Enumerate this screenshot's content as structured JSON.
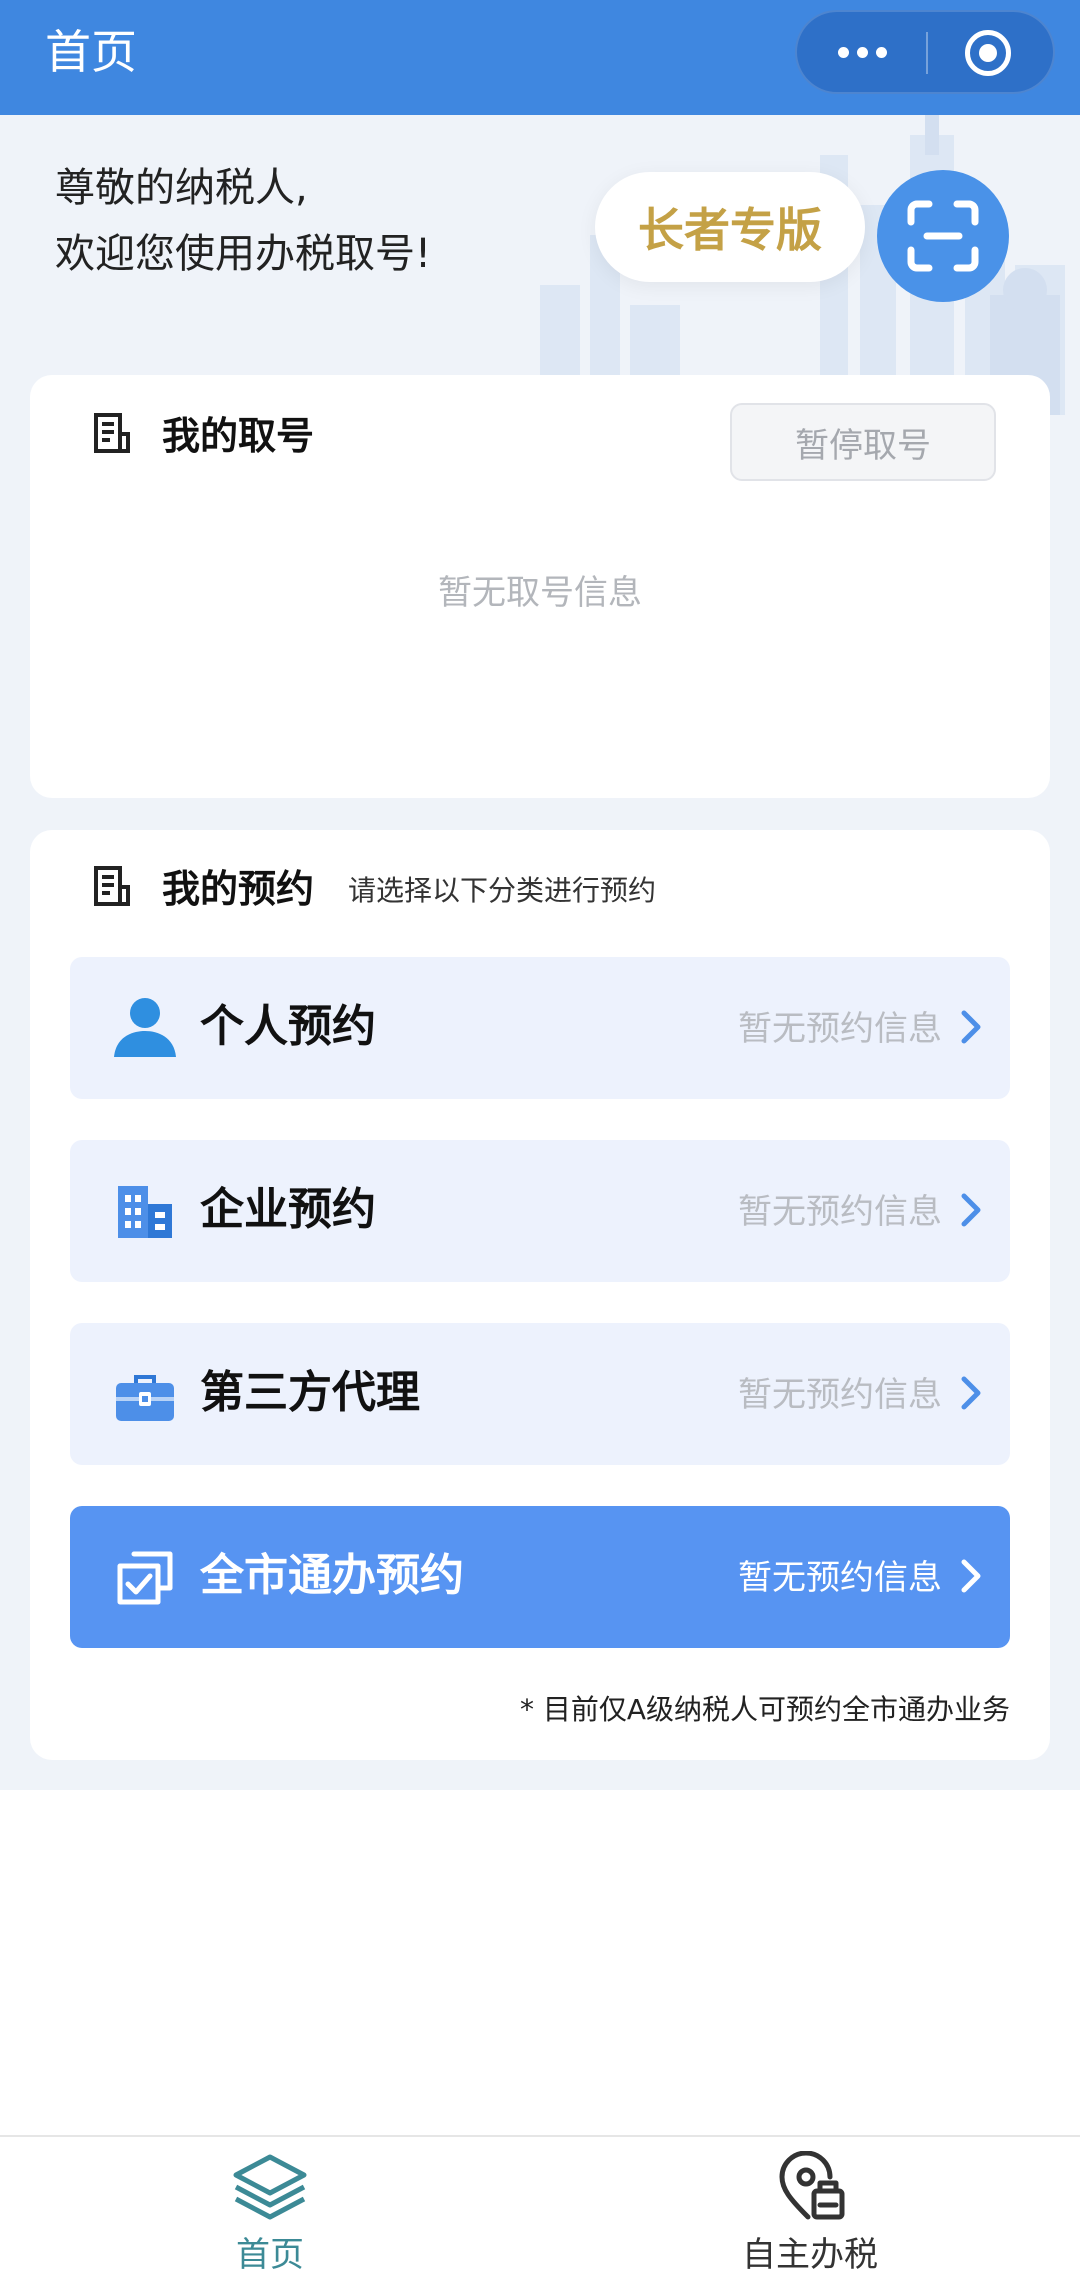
{
  "navbar": {
    "title": "首页",
    "more_icon": "more-dots-icon",
    "close_icon": "target-close-icon"
  },
  "header": {
    "greeting_line1": "尊敬的纳税人,",
    "greeting_line2": "欢迎您使用办税取号!",
    "elder_mode_label": "长者专版",
    "scan_icon": "scan-icon"
  },
  "queue_card": {
    "title": "我的取号",
    "pause_label": "暂停取号",
    "empty_text": "暂无取号信息"
  },
  "appointment_card": {
    "title": "我的预约",
    "subtitle": "请选择以下分类进行预约",
    "items": [
      {
        "label": "个人预约",
        "status": "暂无预约信息",
        "icon": "person-icon"
      },
      {
        "label": "企业预约",
        "status": "暂无预约信息",
        "icon": "building-icon"
      },
      {
        "label": "第三方代理",
        "status": "暂无预约信息",
        "icon": "briefcase-icon"
      },
      {
        "label": "全市通办预约",
        "status": "暂无预约信息",
        "icon": "citywide-check-icon"
      }
    ],
    "footnote": "* 目前仅A级纳税人可预约全市通办业务"
  },
  "tabbar": {
    "tabs": [
      {
        "label": "首页",
        "icon": "layers-icon",
        "active": true
      },
      {
        "label": "自主办税",
        "icon": "location-print-icon",
        "active": false
      }
    ]
  },
  "colors": {
    "brand_blue": "#3f87e0",
    "primary_row": "#5794f2",
    "elder_gold": "#c4a146",
    "active_tab": "#3c8a96"
  }
}
